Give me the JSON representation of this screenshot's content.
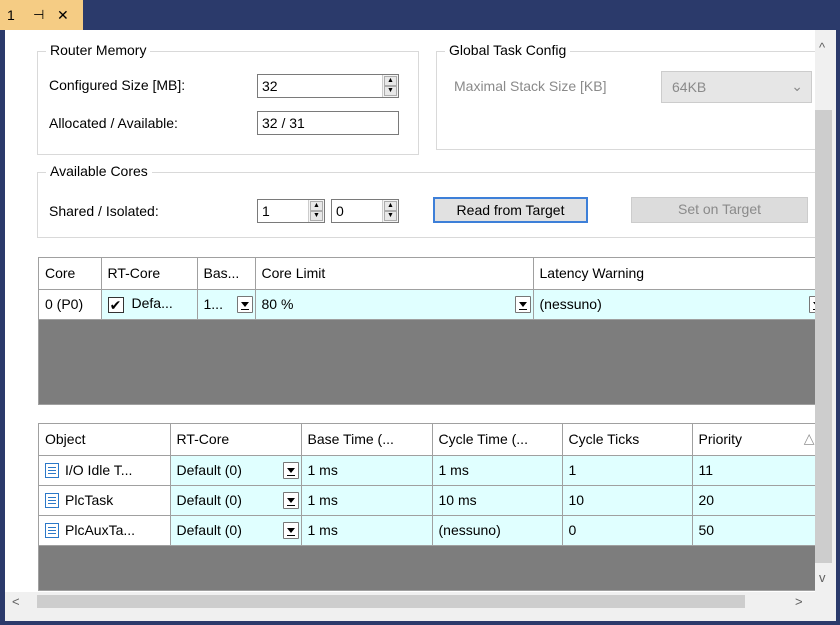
{
  "window": {
    "tab_label": "1",
    "pin_icon": "pin-icon",
    "close_icon": "close-icon"
  },
  "router_memory": {
    "title": "Router Memory",
    "configured_label": "Configured Size [MB]:",
    "configured_value": "32",
    "allocated_label": "Allocated / Available:",
    "allocated_value": "32 / 31"
  },
  "global_task": {
    "title": "Global Task Config",
    "stack_label": "Maximal Stack Size [KB]",
    "stack_value": "64KB"
  },
  "available_cores": {
    "title": "Available Cores",
    "shared_label": "Shared / Isolated:",
    "shared_value": "1",
    "isolated_value": "0",
    "read_button": "Read from Target",
    "set_button": "Set on Target"
  },
  "core_grid": {
    "headers": [
      "Core",
      "RT-Core",
      "Bas...",
      "Core Limit",
      "Latency Warning"
    ],
    "rows": [
      {
        "core": "0 (P0)",
        "rt_core": "Defa...",
        "rt_checked": true,
        "base": "1...",
        "core_limit": "80 %",
        "latency": "(nessuno)"
      }
    ]
  },
  "task_grid": {
    "headers": [
      "Object",
      "RT-Core",
      "Base Time (...",
      "Cycle Time (...",
      "Cycle Ticks",
      "Priority"
    ],
    "sort_icon": "sort-triangle-icon",
    "rows": [
      {
        "object": "I/O Idle T...",
        "rt_core": "Default (0)",
        "base_time": "1 ms",
        "cycle_time": "1 ms",
        "cycle_ticks": "1",
        "priority": "11"
      },
      {
        "object": "PlcTask",
        "rt_core": "Default (0)",
        "base_time": "1 ms",
        "cycle_time": "10 ms",
        "cycle_ticks": "10",
        "priority": "20"
      },
      {
        "object": "PlcAuxTa...",
        "rt_core": "Default (0)",
        "base_time": "1 ms",
        "cycle_time": "(nessuno)",
        "cycle_ticks": "0",
        "priority": "50"
      }
    ]
  },
  "colors": {
    "frame": "#2b3a6b",
    "tab": "#f5cc84",
    "cell_bg": "#e0ffff",
    "grid_empty": "#7d7d7d",
    "button_focus": "#3d7fd8"
  }
}
